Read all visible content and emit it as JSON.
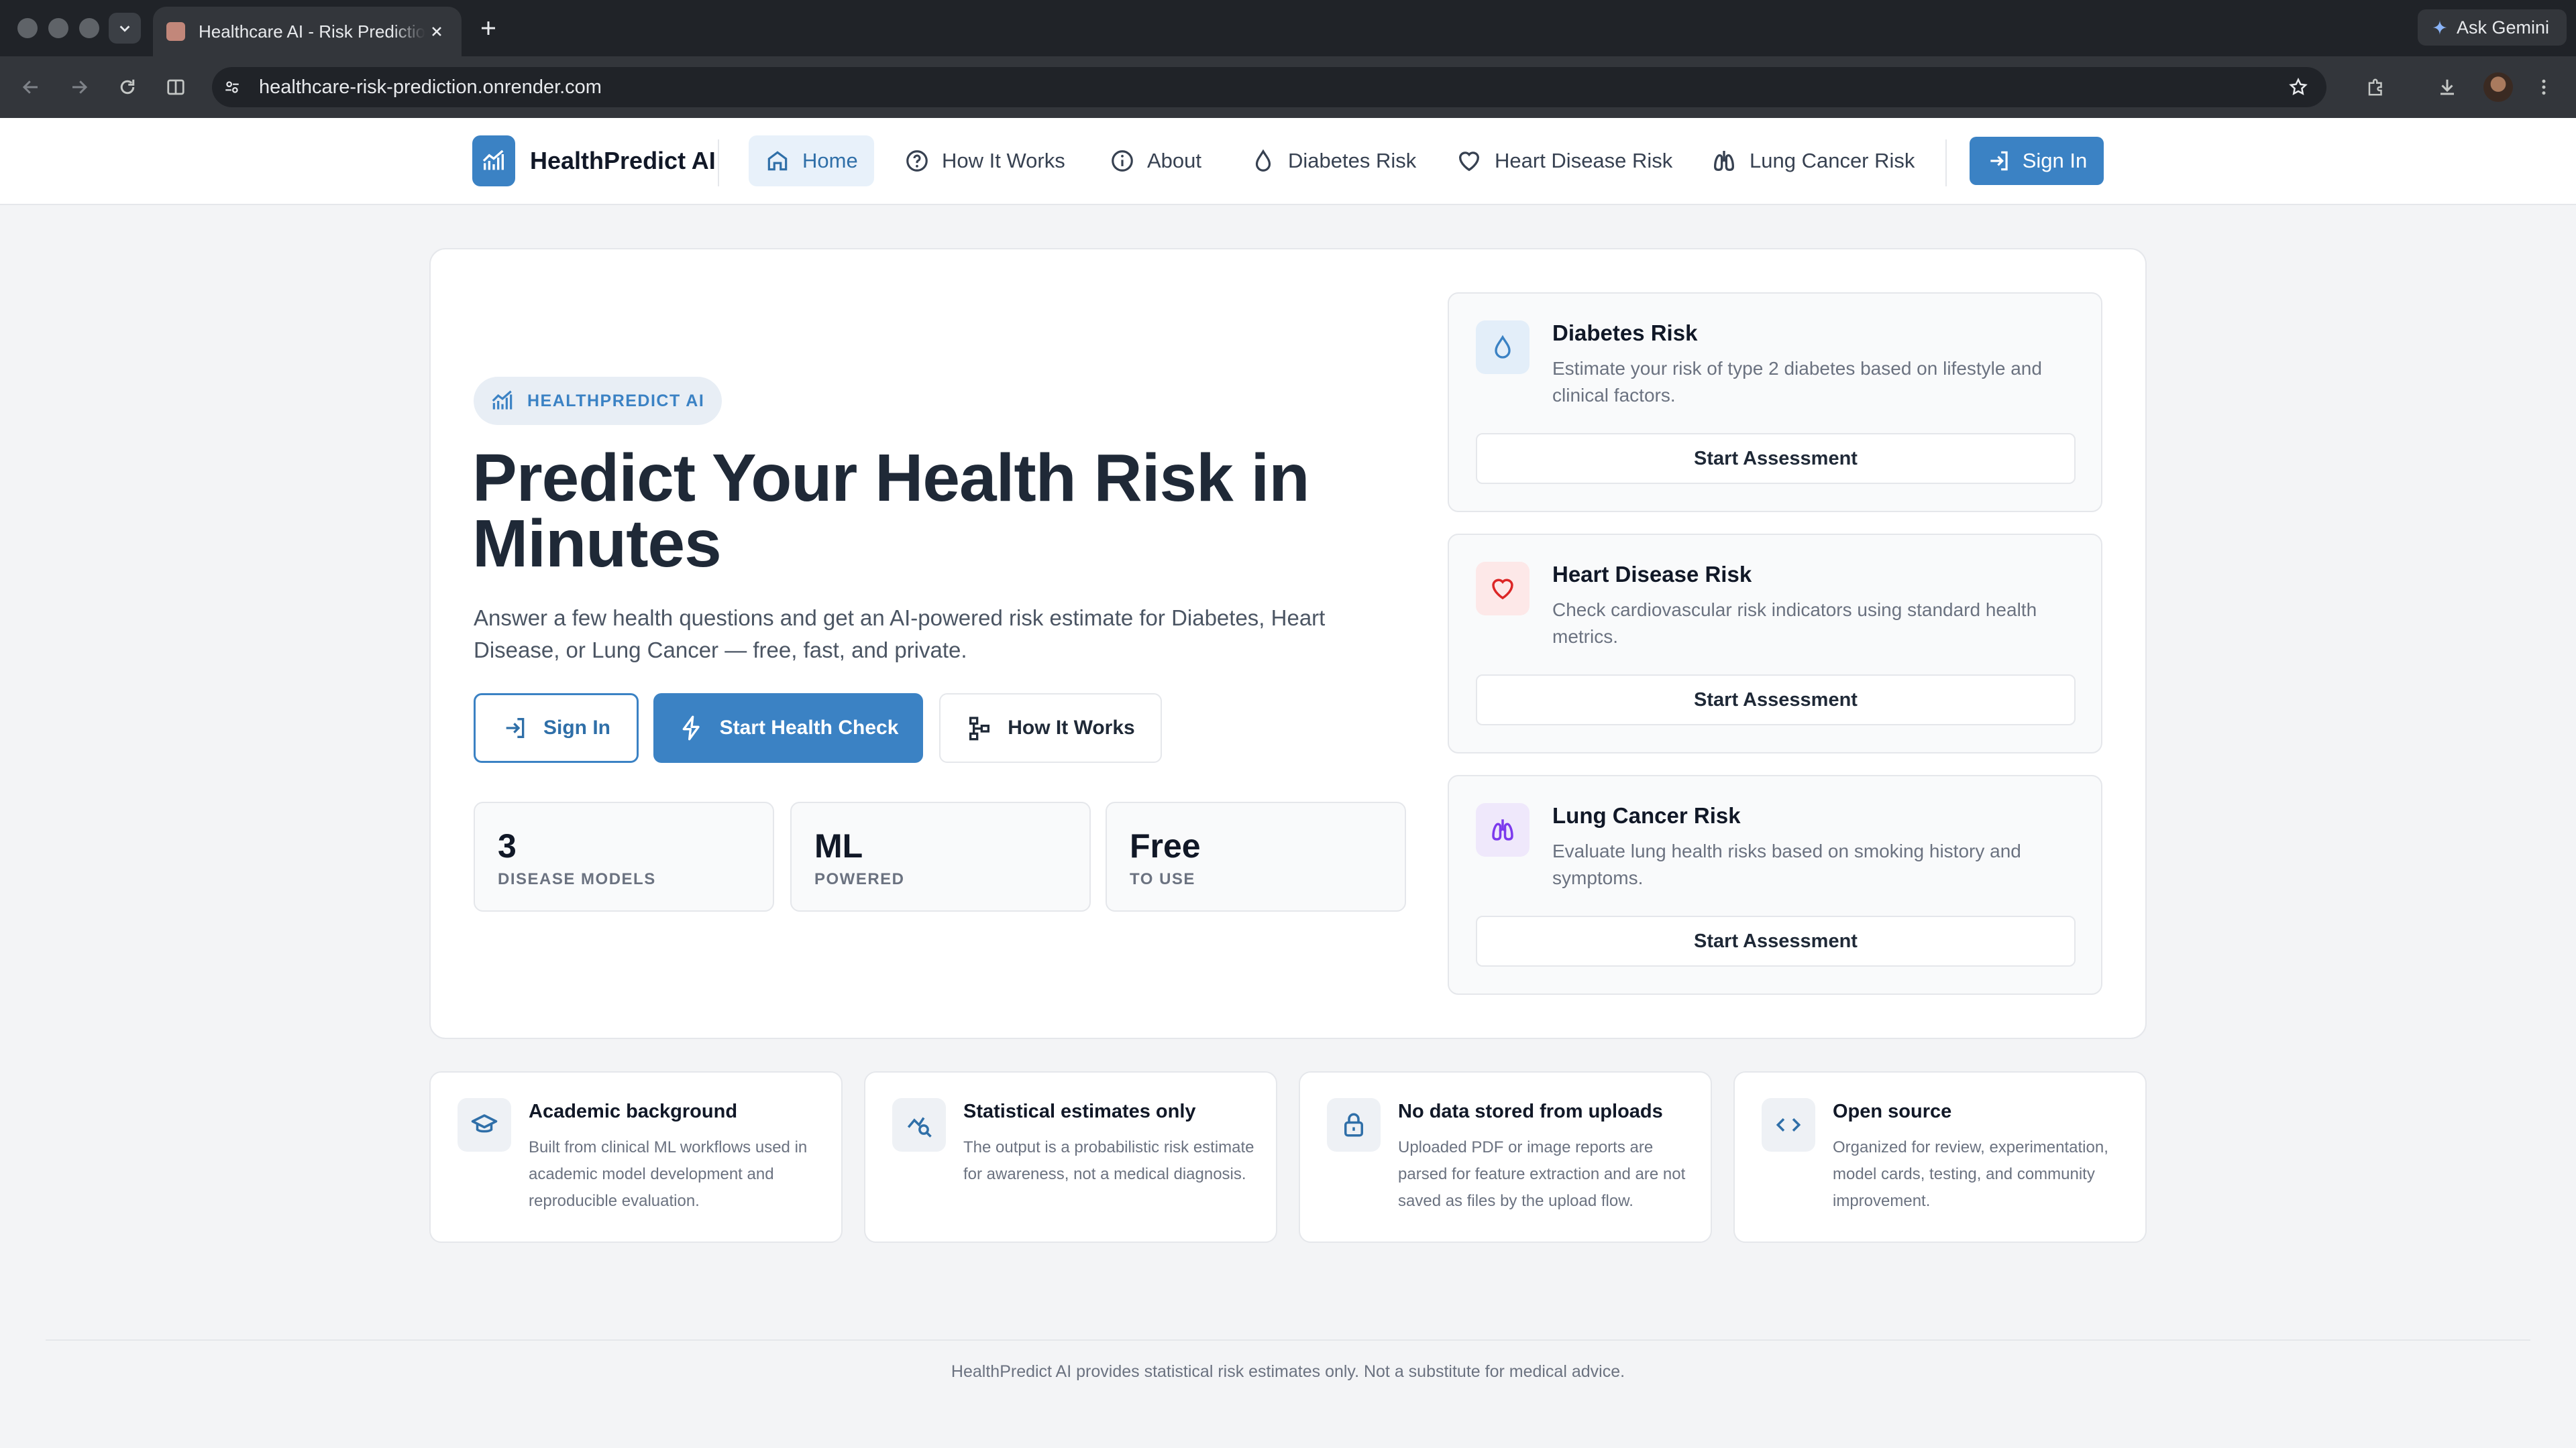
{
  "browser": {
    "tab_title": "Healthcare AI - Risk Prediction",
    "url": "healthcare-risk-prediction.onrender.com",
    "gemini_label": "Ask Gemini"
  },
  "nav": {
    "brand": "HealthPredict AI",
    "items": [
      {
        "label": "Home",
        "icon": "home-icon",
        "active": true
      },
      {
        "label": "How It Works",
        "icon": "help-circle-icon"
      },
      {
        "label": "About",
        "icon": "info-icon"
      },
      {
        "label": "Diabetes Risk",
        "icon": "droplet-icon"
      },
      {
        "label": "Heart Disease Risk",
        "icon": "heart-icon"
      },
      {
        "label": "Lung Cancer Risk",
        "icon": "lungs-icon"
      }
    ],
    "sign_in": "Sign In"
  },
  "hero": {
    "badge": "HEALTHPREDICT AI",
    "title": "Predict Your Health Risk in Minutes",
    "subtitle": "Answer a few health questions and get an AI-powered risk estimate for Diabetes, Heart Disease, or Lung Cancer — free, fast, and private.",
    "buttons": {
      "sign_in": "Sign In",
      "start": "Start Health Check",
      "how": "How It Works"
    },
    "stats": [
      {
        "value": "3",
        "label": "DISEASE MODELS"
      },
      {
        "value": "ML",
        "label": "POWERED"
      },
      {
        "value": "Free",
        "label": "TO USE"
      }
    ]
  },
  "risk_cards": [
    {
      "title": "Diabetes Risk",
      "description": "Estimate your risk of type 2 diabetes based on lifestyle and clinical factors.",
      "button": "Start Assessment",
      "icon": "droplet-icon",
      "accent": "#3b82c4"
    },
    {
      "title": "Heart Disease Risk",
      "description": "Check cardiovascular risk indicators using standard health metrics.",
      "button": "Start Assessment",
      "icon": "heart-icon",
      "accent": "#dc2626"
    },
    {
      "title": "Lung Cancer Risk",
      "description": "Evaluate lung health risks based on smoking history and symptoms.",
      "button": "Start Assessment",
      "icon": "lungs-icon",
      "accent": "#7c3aed"
    }
  ],
  "features": [
    {
      "title": "Academic background",
      "description": "Built from clinical ML workflows used in academic model development and reproducible evaluation.",
      "icon": "graduation-cap-icon"
    },
    {
      "title": "Statistical estimates only",
      "description": "The output is a probabilistic risk estimate for awareness, not a medical diagnosis.",
      "icon": "chart-search-icon"
    },
    {
      "title": "No data stored from uploads",
      "description": "Uploaded PDF or image reports are parsed for feature extraction and are not saved as files by the upload flow.",
      "icon": "lock-icon"
    },
    {
      "title": "Open source",
      "description": "Organized for review, experimentation, model cards, testing, and community improvement.",
      "icon": "code-icon"
    }
  ],
  "footer": "HealthPredict AI provides statistical risk estimates only. Not a substitute for medical advice.",
  "colors": {
    "primary": "#3b82c4",
    "heart": "#dc2626",
    "lung": "#7c3aed",
    "text_dark": "#111827",
    "muted": "#6b7280"
  }
}
